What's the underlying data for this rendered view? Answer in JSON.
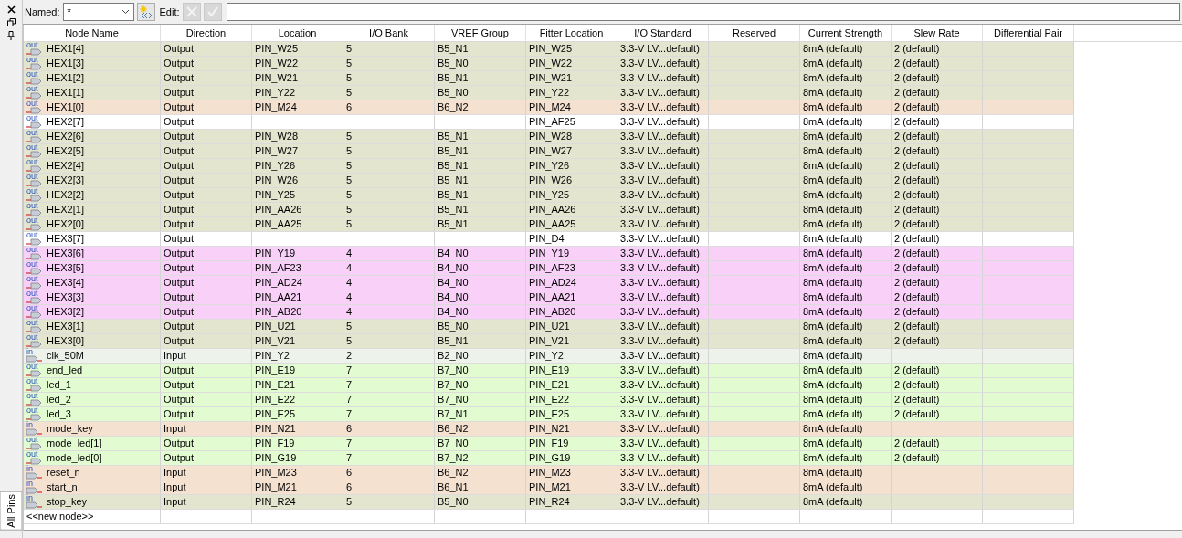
{
  "side_tab": {
    "label": "All Pins"
  },
  "toolbar": {
    "named_label": "Named:",
    "named_value": "*",
    "edit_label": "Edit:",
    "cancel_disabled": true,
    "accept_disabled": true
  },
  "table": {
    "columns": [
      "Node Name",
      "Direction",
      "Location",
      "I/O Bank",
      "VREF Group",
      "Fitter Location",
      "I/O Standard",
      "Reserved",
      "Current Strength",
      "Slew Rate",
      "Differential Pair"
    ],
    "rows": [
      {
        "kind": "out",
        "icon": "out",
        "cells": [
          "HEX1[4]",
          "Output",
          "PIN_W25",
          "5",
          "B5_N1",
          "PIN_W25",
          "3.3-V LV...default)",
          "",
          "8mA (default)",
          "2 (default)",
          ""
        ],
        "color": "#e4e5cf"
      },
      {
        "kind": "out",
        "icon": "out",
        "cells": [
          "HEX1[3]",
          "Output",
          "PIN_W22",
          "5",
          "B5_N0",
          "PIN_W22",
          "3.3-V LV...default)",
          "",
          "8mA (default)",
          "2 (default)",
          ""
        ],
        "color": "#e4e5cf"
      },
      {
        "kind": "out",
        "icon": "out",
        "cells": [
          "HEX1[2]",
          "Output",
          "PIN_W21",
          "5",
          "B5_N1",
          "PIN_W21",
          "3.3-V LV...default)",
          "",
          "8mA (default)",
          "2 (default)",
          ""
        ],
        "color": "#e4e5cf"
      },
      {
        "kind": "out",
        "icon": "out",
        "cells": [
          "HEX1[1]",
          "Output",
          "PIN_Y22",
          "5",
          "B5_N0",
          "PIN_Y22",
          "3.3-V LV...default)",
          "",
          "8mA (default)",
          "2 (default)",
          ""
        ],
        "color": "#e4e5cf"
      },
      {
        "kind": "out",
        "icon": "out",
        "cells": [
          "HEX1[0]",
          "Output",
          "PIN_M24",
          "6",
          "B6_N2",
          "PIN_M24",
          "3.3-V LV...default)",
          "",
          "8mA (default)",
          "2 (default)",
          ""
        ],
        "color": "#f5e1d0"
      },
      {
        "kind": "out",
        "icon": "out",
        "cells": [
          "HEX2[7]",
          "Output",
          "",
          "",
          "",
          "PIN_AF25",
          "3.3-V LV...default)",
          "",
          "8mA (default)",
          "2 (default)",
          ""
        ],
        "color": "#ffffff"
      },
      {
        "kind": "out",
        "icon": "out",
        "cells": [
          "HEX2[6]",
          "Output",
          "PIN_W28",
          "5",
          "B5_N1",
          "PIN_W28",
          "3.3-V LV...default)",
          "",
          "8mA (default)",
          "2 (default)",
          ""
        ],
        "color": "#e4e5cf"
      },
      {
        "kind": "out",
        "icon": "out",
        "cells": [
          "HEX2[5]",
          "Output",
          "PIN_W27",
          "5",
          "B5_N1",
          "PIN_W27",
          "3.3-V LV...default)",
          "",
          "8mA (default)",
          "2 (default)",
          ""
        ],
        "color": "#e4e5cf"
      },
      {
        "kind": "out",
        "icon": "out",
        "cells": [
          "HEX2[4]",
          "Output",
          "PIN_Y26",
          "5",
          "B5_N1",
          "PIN_Y26",
          "3.3-V LV...default)",
          "",
          "8mA (default)",
          "2 (default)",
          ""
        ],
        "color": "#e4e5cf"
      },
      {
        "kind": "out",
        "icon": "out",
        "cells": [
          "HEX2[3]",
          "Output",
          "PIN_W26",
          "5",
          "B5_N1",
          "PIN_W26",
          "3.3-V LV...default)",
          "",
          "8mA (default)",
          "2 (default)",
          ""
        ],
        "color": "#e4e5cf"
      },
      {
        "kind": "out",
        "icon": "out",
        "cells": [
          "HEX2[2]",
          "Output",
          "PIN_Y25",
          "5",
          "B5_N1",
          "PIN_Y25",
          "3.3-V LV...default)",
          "",
          "8mA (default)",
          "2 (default)",
          ""
        ],
        "color": "#e4e5cf"
      },
      {
        "kind": "out",
        "icon": "out",
        "cells": [
          "HEX2[1]",
          "Output",
          "PIN_AA26",
          "5",
          "B5_N1",
          "PIN_AA26",
          "3.3-V LV...default)",
          "",
          "8mA (default)",
          "2 (default)",
          ""
        ],
        "color": "#e4e5cf"
      },
      {
        "kind": "out",
        "icon": "out",
        "cells": [
          "HEX2[0]",
          "Output",
          "PIN_AA25",
          "5",
          "B5_N1",
          "PIN_AA25",
          "3.3-V LV...default)",
          "",
          "8mA (default)",
          "2 (default)",
          ""
        ],
        "color": "#e4e5cf"
      },
      {
        "kind": "out",
        "icon": "out",
        "cells": [
          "HEX3[7]",
          "Output",
          "",
          "",
          "",
          "PIN_D4",
          "3.3-V LV...default)",
          "",
          "8mA (default)",
          "2 (default)",
          ""
        ],
        "color": "#ffffff"
      },
      {
        "kind": "out",
        "icon": "out",
        "cells": [
          "HEX3[6]",
          "Output",
          "PIN_Y19",
          "4",
          "B4_N0",
          "PIN_Y19",
          "3.3-V LV...default)",
          "",
          "8mA (default)",
          "2 (default)",
          ""
        ],
        "color": "#f8d0f8"
      },
      {
        "kind": "out",
        "icon": "out",
        "cells": [
          "HEX3[5]",
          "Output",
          "PIN_AF23",
          "4",
          "B4_N0",
          "PIN_AF23",
          "3.3-V LV...default)",
          "",
          "8mA (default)",
          "2 (default)",
          ""
        ],
        "color": "#f8d0f8"
      },
      {
        "kind": "out",
        "icon": "out",
        "cells": [
          "HEX3[4]",
          "Output",
          "PIN_AD24",
          "4",
          "B4_N0",
          "PIN_AD24",
          "3.3-V LV...default)",
          "",
          "8mA (default)",
          "2 (default)",
          ""
        ],
        "color": "#f8d0f8"
      },
      {
        "kind": "out",
        "icon": "out",
        "cells": [
          "HEX3[3]",
          "Output",
          "PIN_AA21",
          "4",
          "B4_N0",
          "PIN_AA21",
          "3.3-V LV...default)",
          "",
          "8mA (default)",
          "2 (default)",
          ""
        ],
        "color": "#f8d0f8"
      },
      {
        "kind": "out",
        "icon": "out",
        "cells": [
          "HEX3[2]",
          "Output",
          "PIN_AB20",
          "4",
          "B4_N0",
          "PIN_AB20",
          "3.3-V LV...default)",
          "",
          "8mA (default)",
          "2 (default)",
          ""
        ],
        "color": "#f8d0f8"
      },
      {
        "kind": "out",
        "icon": "out",
        "cells": [
          "HEX3[1]",
          "Output",
          "PIN_U21",
          "5",
          "B5_N0",
          "PIN_U21",
          "3.3-V LV...default)",
          "",
          "8mA (default)",
          "2 (default)",
          ""
        ],
        "color": "#e4e5cf"
      },
      {
        "kind": "out",
        "icon": "out",
        "cells": [
          "HEX3[0]",
          "Output",
          "PIN_V21",
          "5",
          "B5_N1",
          "PIN_V21",
          "3.3-V LV...default)",
          "",
          "8mA (default)",
          "2 (default)",
          ""
        ],
        "color": "#e4e5cf"
      },
      {
        "kind": "in",
        "icon": "in",
        "cells": [
          "clk_50M",
          "Input",
          "PIN_Y2",
          "2",
          "B2_N0",
          "PIN_Y2",
          "3.3-V LV...default)",
          "",
          "8mA (default)",
          "",
          ""
        ],
        "color": "#edf2ea"
      },
      {
        "kind": "out",
        "icon": "out",
        "cells": [
          "end_led",
          "Output",
          "PIN_E19",
          "7",
          "B7_N0",
          "PIN_E19",
          "3.3-V LV...default)",
          "",
          "8mA (default)",
          "2 (default)",
          ""
        ],
        "color": "#e3fbd0"
      },
      {
        "kind": "out",
        "icon": "out",
        "cells": [
          "led_1",
          "Output",
          "PIN_E21",
          "7",
          "B7_N0",
          "PIN_E21",
          "3.3-V LV...default)",
          "",
          "8mA (default)",
          "2 (default)",
          ""
        ],
        "color": "#e3fbd0"
      },
      {
        "kind": "out",
        "icon": "out",
        "cells": [
          "led_2",
          "Output",
          "PIN_E22",
          "7",
          "B7_N0",
          "PIN_E22",
          "3.3-V LV...default)",
          "",
          "8mA (default)",
          "2 (default)",
          ""
        ],
        "color": "#e3fbd0"
      },
      {
        "kind": "out",
        "icon": "out",
        "cells": [
          "led_3",
          "Output",
          "PIN_E25",
          "7",
          "B7_N1",
          "PIN_E25",
          "3.3-V LV...default)",
          "",
          "8mA (default)",
          "2 (default)",
          ""
        ],
        "color": "#e3fbd0"
      },
      {
        "kind": "in",
        "icon": "in",
        "cells": [
          "mode_key",
          "Input",
          "PIN_N21",
          "6",
          "B6_N2",
          "PIN_N21",
          "3.3-V LV...default)",
          "",
          "8mA (default)",
          "",
          ""
        ],
        "color": "#f5e1d0"
      },
      {
        "kind": "out",
        "icon": "out",
        "cells": [
          "mode_led[1]",
          "Output",
          "PIN_F19",
          "7",
          "B7_N0",
          "PIN_F19",
          "3.3-V LV...default)",
          "",
          "8mA (default)",
          "2 (default)",
          ""
        ],
        "color": "#e3fbd0"
      },
      {
        "kind": "out",
        "icon": "out",
        "cells": [
          "mode_led[0]",
          "Output",
          "PIN_G19",
          "7",
          "B7_N2",
          "PIN_G19",
          "3.3-V LV...default)",
          "",
          "8mA (default)",
          "2 (default)",
          ""
        ],
        "color": "#e3fbd0"
      },
      {
        "kind": "in",
        "icon": "in",
        "cells": [
          "reset_n",
          "Input",
          "PIN_M23",
          "6",
          "B6_N2",
          "PIN_M23",
          "3.3-V LV...default)",
          "",
          "8mA (default)",
          "",
          ""
        ],
        "color": "#f5e1d0"
      },
      {
        "kind": "in",
        "icon": "in",
        "cells": [
          "start_n",
          "Input",
          "PIN_M21",
          "6",
          "B6_N1",
          "PIN_M21",
          "3.3-V LV...default)",
          "",
          "8mA (default)",
          "",
          ""
        ],
        "color": "#f5e1d0"
      },
      {
        "kind": "in",
        "icon": "in",
        "cells": [
          "stop_key",
          "Input",
          "PIN_R24",
          "5",
          "B5_N0",
          "PIN_R24",
          "3.3-V LV...default)",
          "",
          "8mA (default)",
          "",
          ""
        ],
        "color": "#e4e5cf"
      }
    ],
    "new_node": "<<new node>>"
  }
}
